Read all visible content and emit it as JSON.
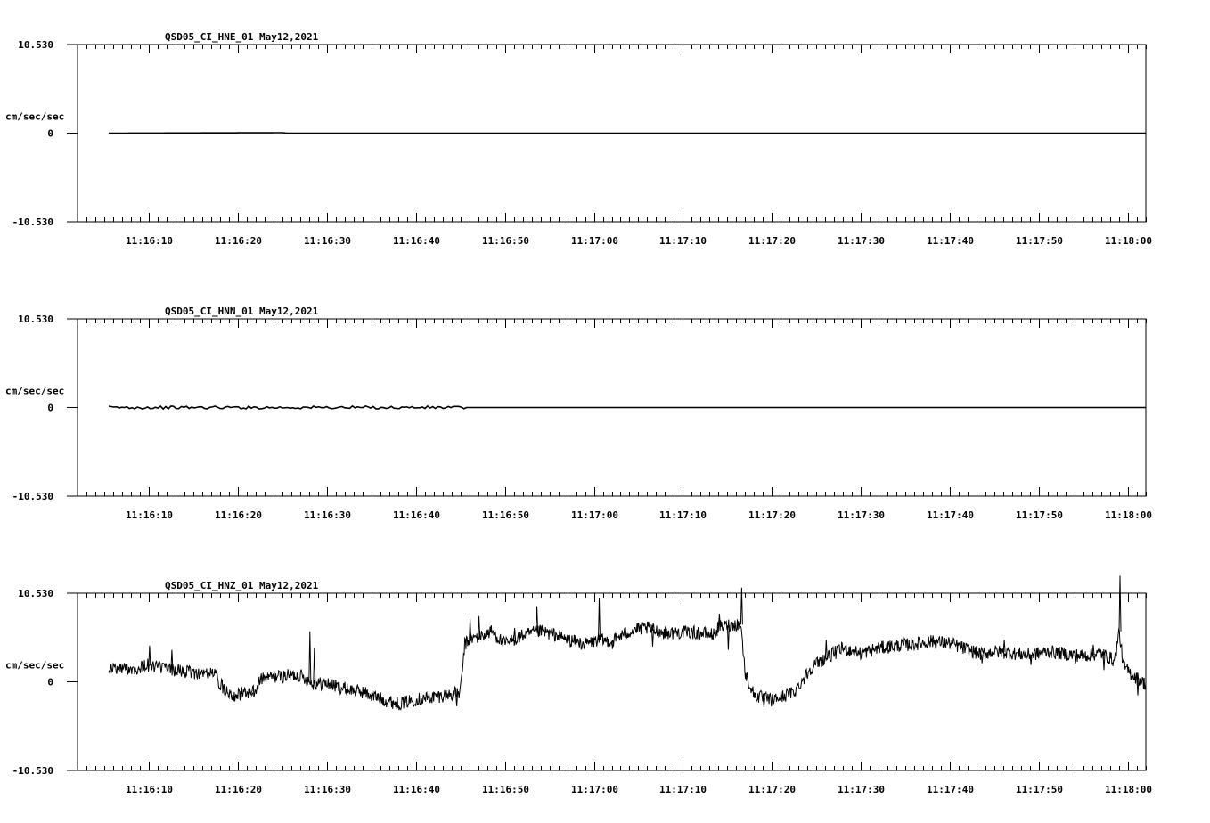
{
  "chart_data": [
    {
      "type": "line",
      "title": "QSD05_CI_HNE_01  May12,2021",
      "ylabel": "cm/sec/sec",
      "y_ticks": [
        "10.530",
        "0",
        "-10.530"
      ],
      "ylim": [
        -10.53,
        10.53
      ],
      "x_ticks": [
        "11:16:10",
        "11:16:20",
        "11:16:30",
        "11:16:40",
        "11:16:50",
        "11:17:00",
        "11:17:10",
        "11:17:20",
        "11:17:30",
        "11:17:40",
        "11:17:50",
        "11:18:00"
      ],
      "xlim": [
        "11:16:02",
        "11:18:02"
      ],
      "series": [
        {
          "values": [
            [
              3.5,
              0.0
            ],
            [
              23.0,
              0.05
            ],
            [
              23.5,
              0.0
            ],
            [
              120,
              0.0
            ]
          ]
        }
      ]
    },
    {
      "type": "line",
      "title": "QSD05_CI_HNN_01  May12,2021",
      "ylabel": "cm/sec/sec",
      "y_ticks": [
        "10.530",
        "0",
        "-10.530"
      ],
      "ylim": [
        -10.53,
        10.53
      ],
      "x_ticks": [
        "11:16:10",
        "11:16:20",
        "11:16:30",
        "11:16:40",
        "11:16:50",
        "11:17:00",
        "11:17:10",
        "11:17:20",
        "11:17:30",
        "11:17:40",
        "11:17:50",
        "11:18:00"
      ],
      "xlim": [
        "11:16:02",
        "11:18:02"
      ],
      "series": [
        {
          "values": [
            [
              3.5,
              0.0
            ],
            [
              43.5,
              0.0
            ],
            [
              120,
              0.0
            ]
          ]
        }
      ]
    },
    {
      "type": "line",
      "title": "QSD05_CI_HNZ_01  May12,2021",
      "ylabel": "cm/sec/sec",
      "y_ticks": [
        "10.530",
        "0",
        "-10.530"
      ],
      "ylim": [
        -10.53,
        10.53
      ],
      "x_ticks": [
        "11:16:10",
        "11:16:20",
        "11:16:30",
        "11:16:40",
        "11:16:50",
        "11:17:00",
        "11:17:10",
        "11:17:20",
        "11:17:30",
        "11:17:40",
        "11:17:50",
        "11:18:00"
      ],
      "xlim": [
        "11:16:02",
        "11:18:02"
      ],
      "series": [
        {
          "values": [
            [
              3.5,
              1.6
            ],
            [
              7.0,
              1.6
            ],
            [
              7.5,
              2.0
            ],
            [
              9.0,
              1.8
            ],
            [
              10.5,
              1.5
            ],
            [
              12.0,
              1.2
            ],
            [
              14.0,
              1.0
            ],
            [
              15.5,
              1.0
            ],
            [
              16.0,
              -0.3
            ],
            [
              17.5,
              -1.6
            ],
            [
              18.5,
              -1.4
            ],
            [
              20.0,
              -1.2
            ],
            [
              20.5,
              0.3
            ],
            [
              22.0,
              0.6
            ],
            [
              25.0,
              0.8
            ],
            [
              26.0,
              0.1
            ],
            [
              26.5,
              -0.2
            ],
            [
              28.0,
              -0.2
            ],
            [
              30.0,
              -0.8
            ],
            [
              32.0,
              -1.2
            ],
            [
              34.0,
              -2.0
            ],
            [
              36.0,
              -2.6
            ],
            [
              38.0,
              -2.1
            ],
            [
              40.0,
              -1.8
            ],
            [
              43.0,
              -1.3
            ],
            [
              43.5,
              4.5
            ],
            [
              44.5,
              5.2
            ],
            [
              45.5,
              5.5
            ],
            [
              46.5,
              6.0
            ],
            [
              48.0,
              4.5
            ],
            [
              50.0,
              5.5
            ],
            [
              52.0,
              6.0
            ],
            [
              54.0,
              5.5
            ],
            [
              55.0,
              5.0
            ],
            [
              57.0,
              4.5
            ],
            [
              58.5,
              5.0
            ],
            [
              60.0,
              4.8
            ],
            [
              61.0,
              5.5
            ],
            [
              62.5,
              6.2
            ],
            [
              64.0,
              6.4
            ],
            [
              66.0,
              5.8
            ],
            [
              68.0,
              5.9
            ],
            [
              70.0,
              5.8
            ],
            [
              71.5,
              5.6
            ],
            [
              72.0,
              6.5
            ],
            [
              73.5,
              6.8
            ],
            [
              74.5,
              6.8
            ],
            [
              75.0,
              1.0
            ],
            [
              76.0,
              -1.6
            ],
            [
              78.0,
              -2.2
            ],
            [
              79.0,
              -1.8
            ],
            [
              80.5,
              -1.2
            ],
            [
              81.5,
              0.3
            ],
            [
              82.5,
              1.8
            ],
            [
              83.5,
              2.5
            ],
            [
              85.0,
              3.4
            ],
            [
              86.0,
              4.0
            ],
            [
              88.0,
              3.4
            ],
            [
              90.0,
              4.0
            ],
            [
              92.0,
              4.3
            ],
            [
              94.0,
              4.5
            ],
            [
              96.0,
              4.8
            ],
            [
              98.0,
              4.6
            ],
            [
              100.0,
              3.8
            ],
            [
              101.5,
              3.3
            ],
            [
              103.0,
              3.6
            ],
            [
              105.0,
              3.4
            ],
            [
              107.0,
              3.2
            ],
            [
              109.0,
              3.6
            ],
            [
              111.0,
              3.3
            ],
            [
              113.0,
              3.1
            ],
            [
              115.0,
              3.4
            ],
            [
              116.5,
              2.5
            ],
            [
              117.0,
              6.0
            ],
            [
              117.5,
              1.8
            ],
            [
              118.5,
              0.8
            ],
            [
              120.0,
              -0.3
            ]
          ],
          "spikes": [
            [
              8.0,
              4.3
            ],
            [
              10.5,
              3.8
            ],
            [
              19.5,
              -1.6
            ],
            [
              26.0,
              6.0
            ],
            [
              26.5,
              4.0
            ],
            [
              42.5,
              -2.9
            ],
            [
              44.0,
              7.5
            ],
            [
              45.0,
              7.8
            ],
            [
              49.0,
              6.4
            ],
            [
              51.5,
              9.0
            ],
            [
              54.0,
              5.5
            ],
            [
              58.5,
              10.0
            ],
            [
              60.0,
              3.9
            ],
            [
              64.5,
              4.2
            ],
            [
              72.0,
              8.1
            ],
            [
              73.0,
              3.8
            ],
            [
              74.5,
              11.2
            ],
            [
              77.0,
              -3.0
            ],
            [
              84.0,
              5.0
            ],
            [
              87.0,
              3.6
            ],
            [
              91.0,
              4.8
            ],
            [
              96.0,
              5.5
            ],
            [
              101.5,
              2.2
            ],
            [
              104.0,
              5.0
            ],
            [
              107.0,
              2.0
            ],
            [
              110.0,
              4.0
            ],
            [
              112.0,
              2.2
            ],
            [
              114.0,
              4.4
            ],
            [
              115.2,
              1.4
            ],
            [
              117.0,
              12.6
            ],
            [
              119.0,
              -1.6
            ]
          ]
        }
      ]
    }
  ]
}
